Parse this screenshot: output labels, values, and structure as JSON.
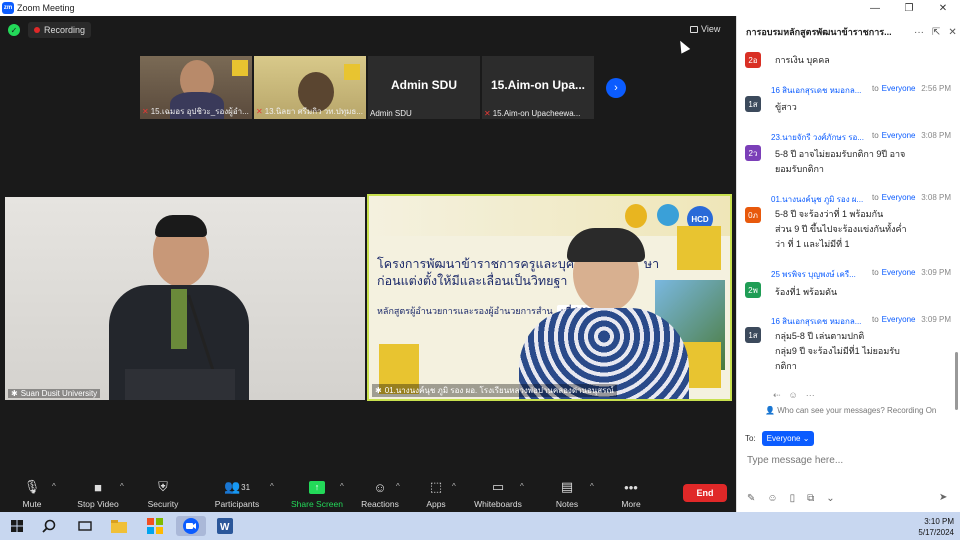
{
  "window": {
    "title": "Zoom Meeting",
    "logo_text": "zm",
    "controls": [
      "—",
      "❐",
      "✕"
    ]
  },
  "meeting": {
    "recording_label": "Recording",
    "view_label": "View"
  },
  "thumbnails": [
    {
      "name": "15.เฉมอร อุปชิวะ_รองผู้อำ...",
      "muted": true
    },
    {
      "name": "13.นิลยา ศรีมกิว วท.ปทุมธ...",
      "muted": true
    },
    {
      "name": "Admin SDU",
      "display": "Admin SDU",
      "muted": false
    },
    {
      "name": "15.Aim-on Upacheewa...",
      "display": "15.Aim-on  Upa...",
      "muted": true
    }
  ],
  "tiles": {
    "left_name": "Suan Dusit University",
    "right_name": "01.นางนงค์นุช ภูมิ รอง ผอ. โรงเรียนหลวงพ่อปานคลองด่านอนุสรณ์",
    "slide_title_line1": "โครงการพัฒนาข้าราชการครูและบุคล",
    "slide_title_line1_end": "ษา",
    "slide_title_line2": "ก่อนแต่งตั้งให้มีและเลื่อนเป็นวิทยฐา",
    "slide_subtitle": "หลักสูตรผู้อำนวยการและรองผู้อำนวยการสำน",
    "slide_badge": "ะที่ 142",
    "slide_logo": "HCD"
  },
  "toolbar": {
    "mute": "Mute",
    "stop_video": "Stop Video",
    "security": "Security",
    "participants": "Participants",
    "participants_count": "31",
    "share_screen": "Share Screen",
    "reactions": "Reactions",
    "apps": "Apps",
    "whiteboards": "Whiteboards",
    "notes": "Notes",
    "more": "More",
    "end": "End"
  },
  "chat": {
    "header": "การอบรมหลักสูตรพัฒนาข้าราชการ...",
    "to_word": "to",
    "messages": [
      {
        "avatar": "2อ",
        "color": "#d93025",
        "sender": "",
        "to": "",
        "time": "",
        "lines": [
          "การเงิน บุคคล"
        ]
      },
      {
        "avatar": "1ส",
        "color": "#3c4a5c",
        "sender": "16 สินเอกสุรเดช  หมอกล...",
        "to": "Everyone",
        "time": "2:56 PM",
        "lines": [
          "ขู้สาว"
        ]
      },
      {
        "avatar": "2ว",
        "color": "#7b3fb8",
        "sender": "23.นายจักรี  วงศ์ภักษร รอ...",
        "to": "Everyone",
        "time": "3:08 PM",
        "lines": [
          "5-8 ปี อาจไม่ยอมรับกติกา 9ปี อาจ",
          "ยอมรับกติกา"
        ]
      },
      {
        "avatar": "0ภ",
        "color": "#e8590c",
        "sender": "01.นางนงค์นุช ภูมิ รอง ผ...",
        "to": "Everyone",
        "time": "3:08 PM",
        "lines": [
          "5-8 ปี จะร้องว่าที่ 1 พร้อมกัน",
          "ส่วน 9 ปี ขึ้นไปจะร้องแข่งกันทั้งค่ำ",
          "ว่า ที่ 1 และไม่มีที่ 1"
        ]
      },
      {
        "avatar": "2พ",
        "color": "#1f9d55",
        "sender": "25 พรพิจร บุญพงษ์ เครื...",
        "to": "Everyone",
        "time": "3:09 PM",
        "lines": [
          "ร้องที่1 พร้อมดัน"
        ]
      },
      {
        "avatar": "1ส",
        "color": "#3c4a5c",
        "sender": "16 สินเอกสุรเดช  หมอกล...",
        "to": "Everyone",
        "time": "3:09 PM",
        "lines": [
          "กลุ่ม5-8 ปี เล่นตามปกติ",
          "กลุ่ม9 ปี จะร้องไม่มีที่1 ไม่ยอมรับ",
          "กติกา"
        ]
      }
    ],
    "who_can_see": "Who can see your messages? Recording On",
    "to_label": "To:",
    "to_value": "Everyone",
    "input_placeholder": "Type message here..."
  },
  "taskbar": {
    "time": "3:10 PM",
    "date": "5/17/2024"
  }
}
